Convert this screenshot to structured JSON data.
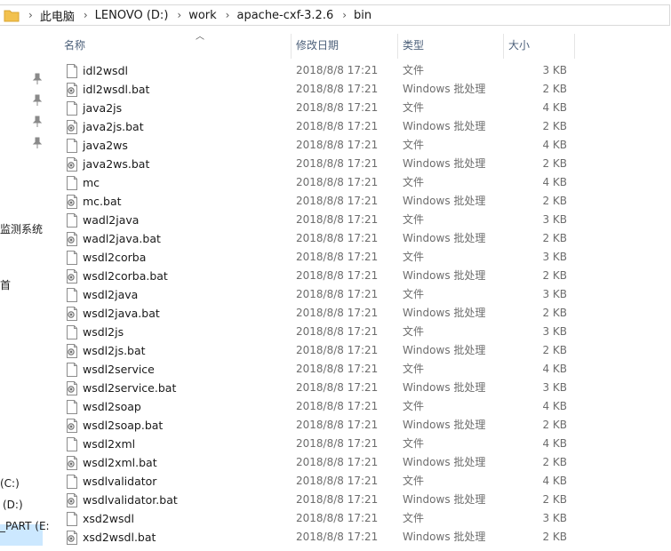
{
  "breadcrumb": [
    "此电脑",
    "LENOVO (D:)",
    "work",
    "apache-cxf-3.2.6",
    "bin"
  ],
  "columns": {
    "name": "名称",
    "date": "修改日期",
    "type": "类型",
    "size": "大小"
  },
  "nav": {
    "item1": "监测系统",
    "item2": "首",
    "drive_c": "(C:)",
    "drive_d": "(D:)",
    "drive_e": "_PART (E:"
  },
  "files": [
    {
      "name": "idl2wsdl",
      "date": "2018/8/8 17:21",
      "type": "文件",
      "size": "3 KB",
      "icon": "file-icon"
    },
    {
      "name": "idl2wsdl.bat",
      "date": "2018/8/8 17:21",
      "type": "Windows 批处理",
      "size": "2 KB",
      "icon": "bat-file-icon"
    },
    {
      "name": "java2js",
      "date": "2018/8/8 17:21",
      "type": "文件",
      "size": "4 KB",
      "icon": "file-icon"
    },
    {
      "name": "java2js.bat",
      "date": "2018/8/8 17:21",
      "type": "Windows 批处理",
      "size": "2 KB",
      "icon": "bat-file-icon"
    },
    {
      "name": "java2ws",
      "date": "2018/8/8 17:21",
      "type": "文件",
      "size": "4 KB",
      "icon": "file-icon"
    },
    {
      "name": "java2ws.bat",
      "date": "2018/8/8 17:21",
      "type": "Windows 批处理",
      "size": "2 KB",
      "icon": "bat-file-icon"
    },
    {
      "name": "mc",
      "date": "2018/8/8 17:21",
      "type": "文件",
      "size": "4 KB",
      "icon": "file-icon"
    },
    {
      "name": "mc.bat",
      "date": "2018/8/8 17:21",
      "type": "Windows 批处理",
      "size": "2 KB",
      "icon": "bat-file-icon"
    },
    {
      "name": "wadl2java",
      "date": "2018/8/8 17:21",
      "type": "文件",
      "size": "3 KB",
      "icon": "file-icon"
    },
    {
      "name": "wadl2java.bat",
      "date": "2018/8/8 17:21",
      "type": "Windows 批处理",
      "size": "2 KB",
      "icon": "bat-file-icon"
    },
    {
      "name": "wsdl2corba",
      "date": "2018/8/8 17:21",
      "type": "文件",
      "size": "3 KB",
      "icon": "file-icon"
    },
    {
      "name": "wsdl2corba.bat",
      "date": "2018/8/8 17:21",
      "type": "Windows 批处理",
      "size": "2 KB",
      "icon": "bat-file-icon"
    },
    {
      "name": "wsdl2java",
      "date": "2018/8/8 17:21",
      "type": "文件",
      "size": "3 KB",
      "icon": "file-icon"
    },
    {
      "name": "wsdl2java.bat",
      "date": "2018/8/8 17:21",
      "type": "Windows 批处理",
      "size": "2 KB",
      "icon": "bat-file-icon"
    },
    {
      "name": "wsdl2js",
      "date": "2018/8/8 17:21",
      "type": "文件",
      "size": "3 KB",
      "icon": "file-icon"
    },
    {
      "name": "wsdl2js.bat",
      "date": "2018/8/8 17:21",
      "type": "Windows 批处理",
      "size": "2 KB",
      "icon": "bat-file-icon"
    },
    {
      "name": "wsdl2service",
      "date": "2018/8/8 17:21",
      "type": "文件",
      "size": "4 KB",
      "icon": "file-icon"
    },
    {
      "name": "wsdl2service.bat",
      "date": "2018/8/8 17:21",
      "type": "Windows 批处理",
      "size": "3 KB",
      "icon": "bat-file-icon"
    },
    {
      "name": "wsdl2soap",
      "date": "2018/8/8 17:21",
      "type": "文件",
      "size": "4 KB",
      "icon": "file-icon"
    },
    {
      "name": "wsdl2soap.bat",
      "date": "2018/8/8 17:21",
      "type": "Windows 批处理",
      "size": "2 KB",
      "icon": "bat-file-icon"
    },
    {
      "name": "wsdl2xml",
      "date": "2018/8/8 17:21",
      "type": "文件",
      "size": "4 KB",
      "icon": "file-icon"
    },
    {
      "name": "wsdl2xml.bat",
      "date": "2018/8/8 17:21",
      "type": "Windows 批处理",
      "size": "2 KB",
      "icon": "bat-file-icon"
    },
    {
      "name": "wsdlvalidator",
      "date": "2018/8/8 17:21",
      "type": "文件",
      "size": "4 KB",
      "icon": "file-icon"
    },
    {
      "name": "wsdlvalidator.bat",
      "date": "2018/8/8 17:21",
      "type": "Windows 批处理",
      "size": "2 KB",
      "icon": "bat-file-icon"
    },
    {
      "name": "xsd2wsdl",
      "date": "2018/8/8 17:21",
      "type": "文件",
      "size": "3 KB",
      "icon": "file-icon"
    },
    {
      "name": "xsd2wsdl.bat",
      "date": "2018/8/8 17:21",
      "type": "Windows 批处理",
      "size": "2 KB",
      "icon": "bat-file-icon"
    }
  ],
  "colors": {
    "header_text": "#4c607a",
    "meta_text": "#6d6d6d",
    "selected_bg": "#cce8ff",
    "folder": "#f2c14e"
  }
}
